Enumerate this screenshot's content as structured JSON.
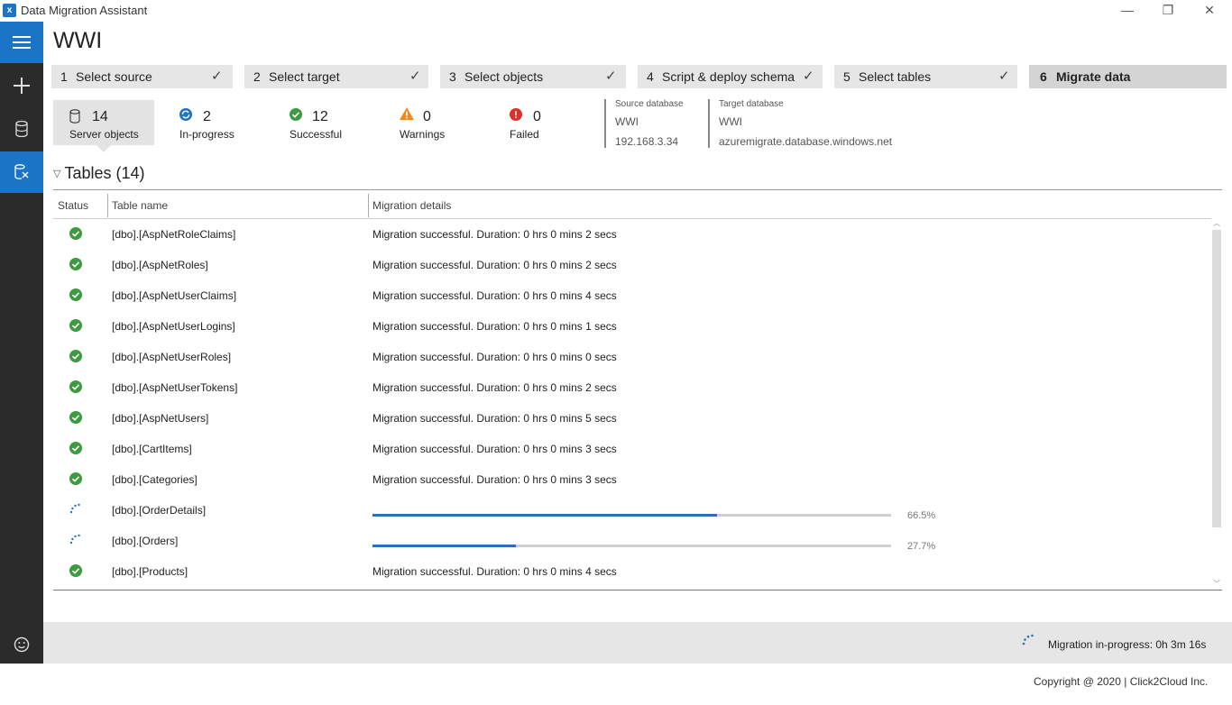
{
  "app": {
    "title": "Data Migration Assistant",
    "logo_glyph": "x"
  },
  "window_controls": {
    "minimize": "—",
    "restore": "❐",
    "close": "✕"
  },
  "rail": {
    "items": [
      {
        "name": "menu",
        "icon": "hamburger-icon"
      },
      {
        "name": "new-project",
        "icon": "plus-icon"
      },
      {
        "name": "assessments",
        "icon": "database-icon"
      },
      {
        "name": "migrations",
        "icon": "migration-icon",
        "active": true
      },
      {
        "name": "feedback",
        "icon": "smiley-icon"
      }
    ]
  },
  "page": {
    "title": "WWI"
  },
  "steps": [
    {
      "num": "1",
      "label": "Select source",
      "done": true
    },
    {
      "num": "2",
      "label": "Select target",
      "done": true
    },
    {
      "num": "3",
      "label": "Select objects",
      "done": true
    },
    {
      "num": "4",
      "label": "Script & deploy schema",
      "done": true
    },
    {
      "num": "5",
      "label": "Select tables",
      "done": true
    },
    {
      "num": "6",
      "label": "Migrate data",
      "done": false,
      "current": true
    }
  ],
  "check_glyph": "✓",
  "summary": {
    "server_objects": {
      "count": "14",
      "label": "Server objects"
    },
    "in_progress": {
      "count": "2",
      "label": "In-progress"
    },
    "successful": {
      "count": "12",
      "label": "Successful"
    },
    "warnings": {
      "count": "0",
      "label": "Warnings"
    },
    "failed": {
      "count": "0",
      "label": "Failed"
    }
  },
  "source_db": {
    "heading": "Source database",
    "name": "WWI",
    "server": "192.168.3.34"
  },
  "target_db": {
    "heading": "Target database",
    "name": "WWI",
    "server": "azuremigrate.database.windows.net"
  },
  "tables": {
    "heading": "Tables (14)",
    "columns": {
      "status": "Status",
      "name": "Table name",
      "details": "Migration details"
    },
    "rows": [
      {
        "status": "success",
        "name": "[dbo].[AspNetRoleClaims]",
        "detail": "Migration successful. Duration: 0 hrs 0 mins 2 secs"
      },
      {
        "status": "success",
        "name": "[dbo].[AspNetRoles]",
        "detail": "Migration successful. Duration: 0 hrs 0 mins 2 secs"
      },
      {
        "status": "success",
        "name": "[dbo].[AspNetUserClaims]",
        "detail": "Migration successful. Duration: 0 hrs 0 mins 4 secs"
      },
      {
        "status": "success",
        "name": "[dbo].[AspNetUserLogins]",
        "detail": "Migration successful. Duration: 0 hrs 0 mins 1 secs"
      },
      {
        "status": "success",
        "name": "[dbo].[AspNetUserRoles]",
        "detail": "Migration successful. Duration: 0 hrs 0 mins 0 secs"
      },
      {
        "status": "success",
        "name": "[dbo].[AspNetUserTokens]",
        "detail": "Migration successful. Duration: 0 hrs 0 mins 2 secs"
      },
      {
        "status": "success",
        "name": "[dbo].[AspNetUsers]",
        "detail": "Migration successful. Duration: 0 hrs 0 mins 5 secs"
      },
      {
        "status": "success",
        "name": "[dbo].[CartItems]",
        "detail": "Migration successful. Duration: 0 hrs 0 mins 3 secs"
      },
      {
        "status": "success",
        "name": "[dbo].[Categories]",
        "detail": "Migration successful. Duration: 0 hrs 0 mins 3 secs"
      },
      {
        "status": "in-progress",
        "name": "[dbo].[OrderDetails]",
        "progress": 0.665,
        "progress_label": "66.5%"
      },
      {
        "status": "in-progress",
        "name": "[dbo].[Orders]",
        "progress": 0.277,
        "progress_label": "27.7%"
      },
      {
        "status": "success",
        "name": "[dbo].[Products]",
        "detail": "Migration successful. Duration: 0 hrs 0 mins 4 secs"
      }
    ]
  },
  "statusbar": {
    "text": "Migration in-progress:  0h 3m 16s"
  },
  "footer": {
    "copyright": "Copyright @ 2020  |   Click2Cloud Inc."
  },
  "colors": {
    "accent": "#1b74c5",
    "success": "#3e9a40",
    "warning": "#f08a1c",
    "error": "#e0302a",
    "progress": "#2d6fb6"
  }
}
